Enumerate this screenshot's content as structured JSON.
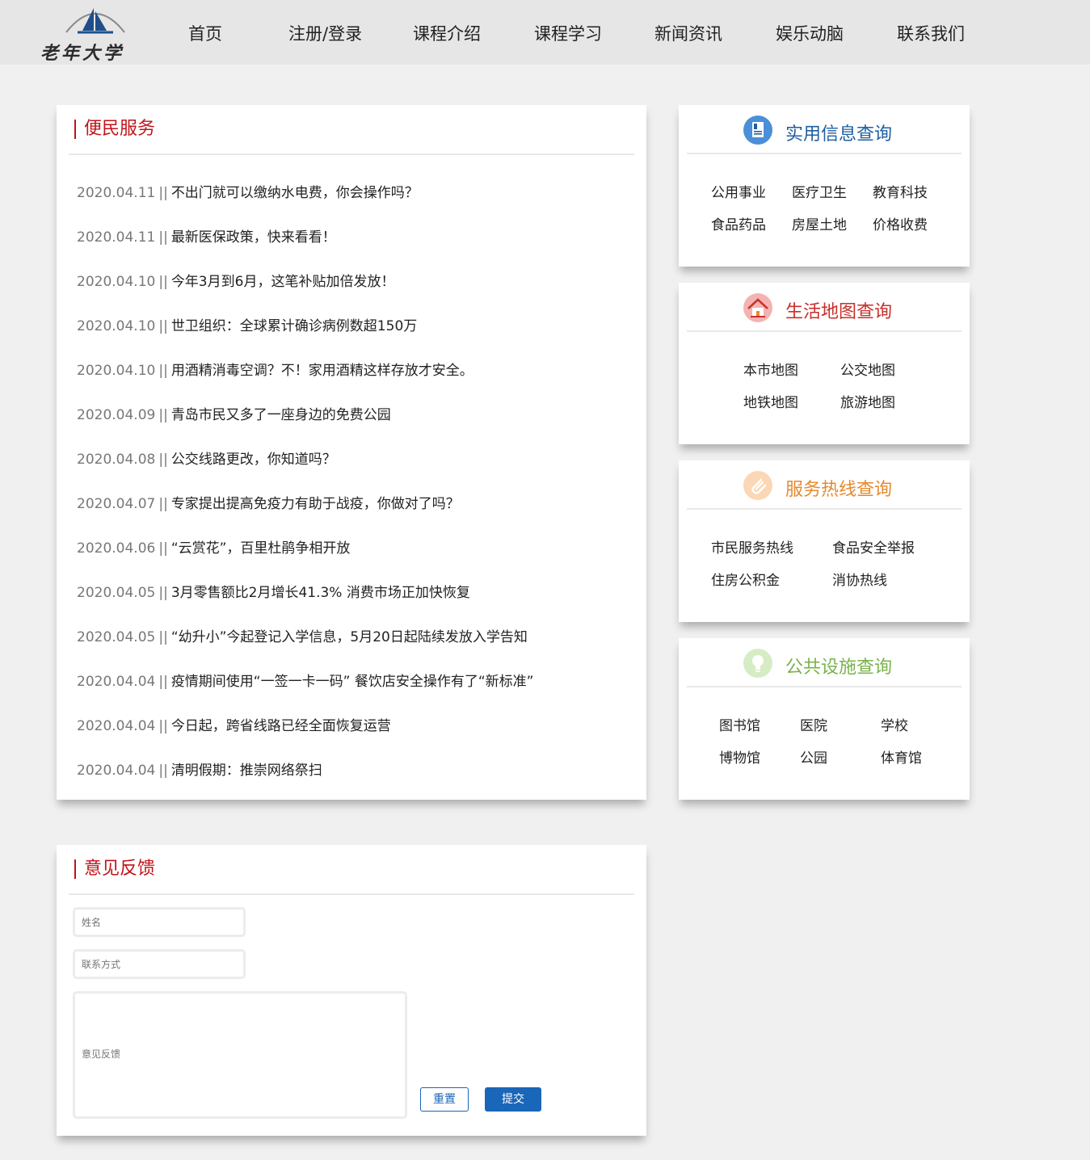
{
  "logo": {
    "text": "老年大学"
  },
  "nav": [
    {
      "label": "首页"
    },
    {
      "label": "注册/登录"
    },
    {
      "label": "课程介绍"
    },
    {
      "label": "课程学习"
    },
    {
      "label": "新闻资讯"
    },
    {
      "label": "娱乐动脑"
    },
    {
      "label": "联系我们"
    }
  ],
  "services": {
    "title": "便民服务",
    "items": [
      {
        "date": "2020.04.11",
        "sep": "||",
        "text": "不出门就可以缴纳水电费，你会操作吗？"
      },
      {
        "date": "2020.04.11",
        "sep": "||",
        "text": "最新医保政策，快来看看！"
      },
      {
        "date": "2020.04.10",
        "sep": "||",
        "text": "今年3月到6月，这笔补贴加倍发放！"
      },
      {
        "date": "2020.04.10",
        "sep": "||",
        "text": "世卫组织：全球累计确诊病例数超150万"
      },
      {
        "date": "2020.04.10",
        "sep": "||",
        "text": "用酒精消毒空调？不！家用酒精这样存放才安全。"
      },
      {
        "date": "2020.04.09",
        "sep": "||",
        "text": "青岛市民又多了一座身边的免费公园"
      },
      {
        "date": "2020.04.08",
        "sep": "||",
        "text": "公交线路更改，你知道吗？"
      },
      {
        "date": "2020.04.07",
        "sep": "||",
        "text": "专家提出提高免疫力有助于战疫，你做对了吗？"
      },
      {
        "date": "2020.04.06",
        "sep": "||",
        "text": "“云赏花”，百里杜鹃争相开放"
      },
      {
        "date": "2020.04.05",
        "sep": "||",
        "text": "3月零售额比2月增长41.3% 消费市场正加快恢复"
      },
      {
        "date": "2020.04.05",
        "sep": "||",
        "text": "“幼升小”今起登记入学信息，5月20日起陆续发放入学告知"
      },
      {
        "date": "2020.04.04",
        "sep": "||",
        "text": "疫情期间使用“一签一卡一码” 餐饮店安全操作有了“新标准”"
      },
      {
        "date": "2020.04.04",
        "sep": "||",
        "text": "今日起，跨省线路已经全面恢复运营"
      },
      {
        "date": "2020.04.04",
        "sep": "||",
        "text": "清明假期：推崇网络祭扫"
      }
    ]
  },
  "side": {
    "info": {
      "title": "实用信息查询",
      "color": "#1f5fa0",
      "icon_color": "#4a8fd8",
      "icon": "document-icon",
      "links": [
        "公用事业",
        "医疗卫生",
        "教育科技",
        "食品药品",
        "房屋土地",
        "价格收费"
      ]
    },
    "map": {
      "title": "生活地图查询",
      "color": "#c8302c",
      "icon_color": "#f3b3b1",
      "icon": "house-icon",
      "links": [
        "本市地图",
        "公交地图",
        "地铁地图",
        "旅游地图"
      ]
    },
    "hotline": {
      "title": "服务热线查询",
      "color": "#e58a2e",
      "icon_color": "#fbd7b5",
      "icon": "paperclip-icon",
      "links": [
        "市民服务热线",
        "食品安全举报",
        "住房公积金",
        "消协热线"
      ]
    },
    "facility": {
      "title": "公共设施查询",
      "color": "#7ab34a",
      "icon_color": "#d6ecc4",
      "icon": "lightbulb-icon",
      "links": [
        "图书馆",
        "医院",
        "学校",
        "博物馆",
        "公园",
        "体育馆"
      ]
    }
  },
  "feedback": {
    "title": "意见反馈",
    "name_placeholder": "姓名",
    "contact_placeholder": "联系方式",
    "message_placeholder": "意见反馈",
    "reset_label": "重置",
    "submit_label": "提交"
  },
  "colors": {
    "accent_red": "#c0141a",
    "button_blue": "#1a66b8",
    "header_bg": "#e6e6e6",
    "page_bg": "#f0f0f0"
  }
}
